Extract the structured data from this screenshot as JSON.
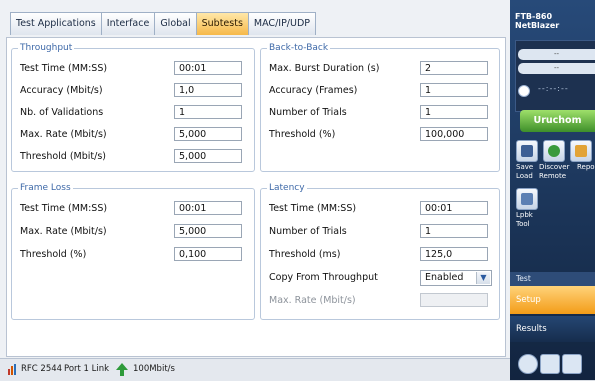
{
  "tabs": [
    {
      "label": "Test Applications",
      "active": false
    },
    {
      "label": "Interface",
      "active": false
    },
    {
      "label": "Global",
      "active": false
    },
    {
      "label": "Subtests",
      "active": true
    },
    {
      "label": "MAC/IP/UDP",
      "active": false
    }
  ],
  "throughput": {
    "title": "Throughput",
    "rows": [
      {
        "label": "Test Time (MM:SS)",
        "value": "00:01"
      },
      {
        "label": "Accuracy (Mbit/s)",
        "value": "1,0"
      },
      {
        "label": "Nb. of Validations",
        "value": "1"
      },
      {
        "label": "Max. Rate (Mbit/s)",
        "value": "5,000"
      },
      {
        "label": "Threshold (Mbit/s)",
        "value": "5,000"
      }
    ]
  },
  "back_to_back": {
    "title": "Back-to-Back",
    "rows": [
      {
        "label": "Max. Burst Duration (s)",
        "value": "2"
      },
      {
        "label": "Accuracy (Frames)",
        "value": "1"
      },
      {
        "label": "Number of Trials",
        "value": "1"
      },
      {
        "label": "Threshold (%)",
        "value": "100,000"
      }
    ]
  },
  "frame_loss": {
    "title": "Frame Loss",
    "rows": [
      {
        "label": "Test Time (MM:SS)",
        "value": "00:01"
      },
      {
        "label": "Max. Rate (Mbit/s)",
        "value": "5,000"
      },
      {
        "label": "Threshold (%)",
        "value": "0,100"
      }
    ]
  },
  "latency": {
    "title": "Latency",
    "rows": [
      {
        "label": "Test Time (MM:SS)",
        "value": "00:01"
      },
      {
        "label": "Number of Trials",
        "value": "1"
      },
      {
        "label": "Threshold (ms)",
        "value": "125,0"
      }
    ],
    "copy_from_throughput": {
      "label": "Copy From Throughput",
      "value": "Enabled"
    },
    "max_rate": {
      "label": "Max. Rate (Mbit/s)",
      "value": ""
    }
  },
  "status": {
    "test": "RFC 2544",
    "port": "Port 1 Link",
    "rate": "100Mbit/s"
  },
  "sidebar": {
    "model": "FTB-860",
    "product": "NetBlazer",
    "pill1": "--",
    "pill2": "--",
    "timer": "--:--:--",
    "start_label": "Uruchom",
    "save_load": "Save\nLoad",
    "discover_remote": "Discover\nRemote",
    "report": "Repo",
    "lpbk_tool": "Lpbk\nTool",
    "section_label": "Test",
    "setup_label": "Setup",
    "results_label": "Results"
  },
  "colors": {
    "accent_orange": "#f6b94b",
    "group_title_blue": "#3e69a8",
    "start_green": "#3e8f2a",
    "sidebar_navy": "#1d3150"
  }
}
